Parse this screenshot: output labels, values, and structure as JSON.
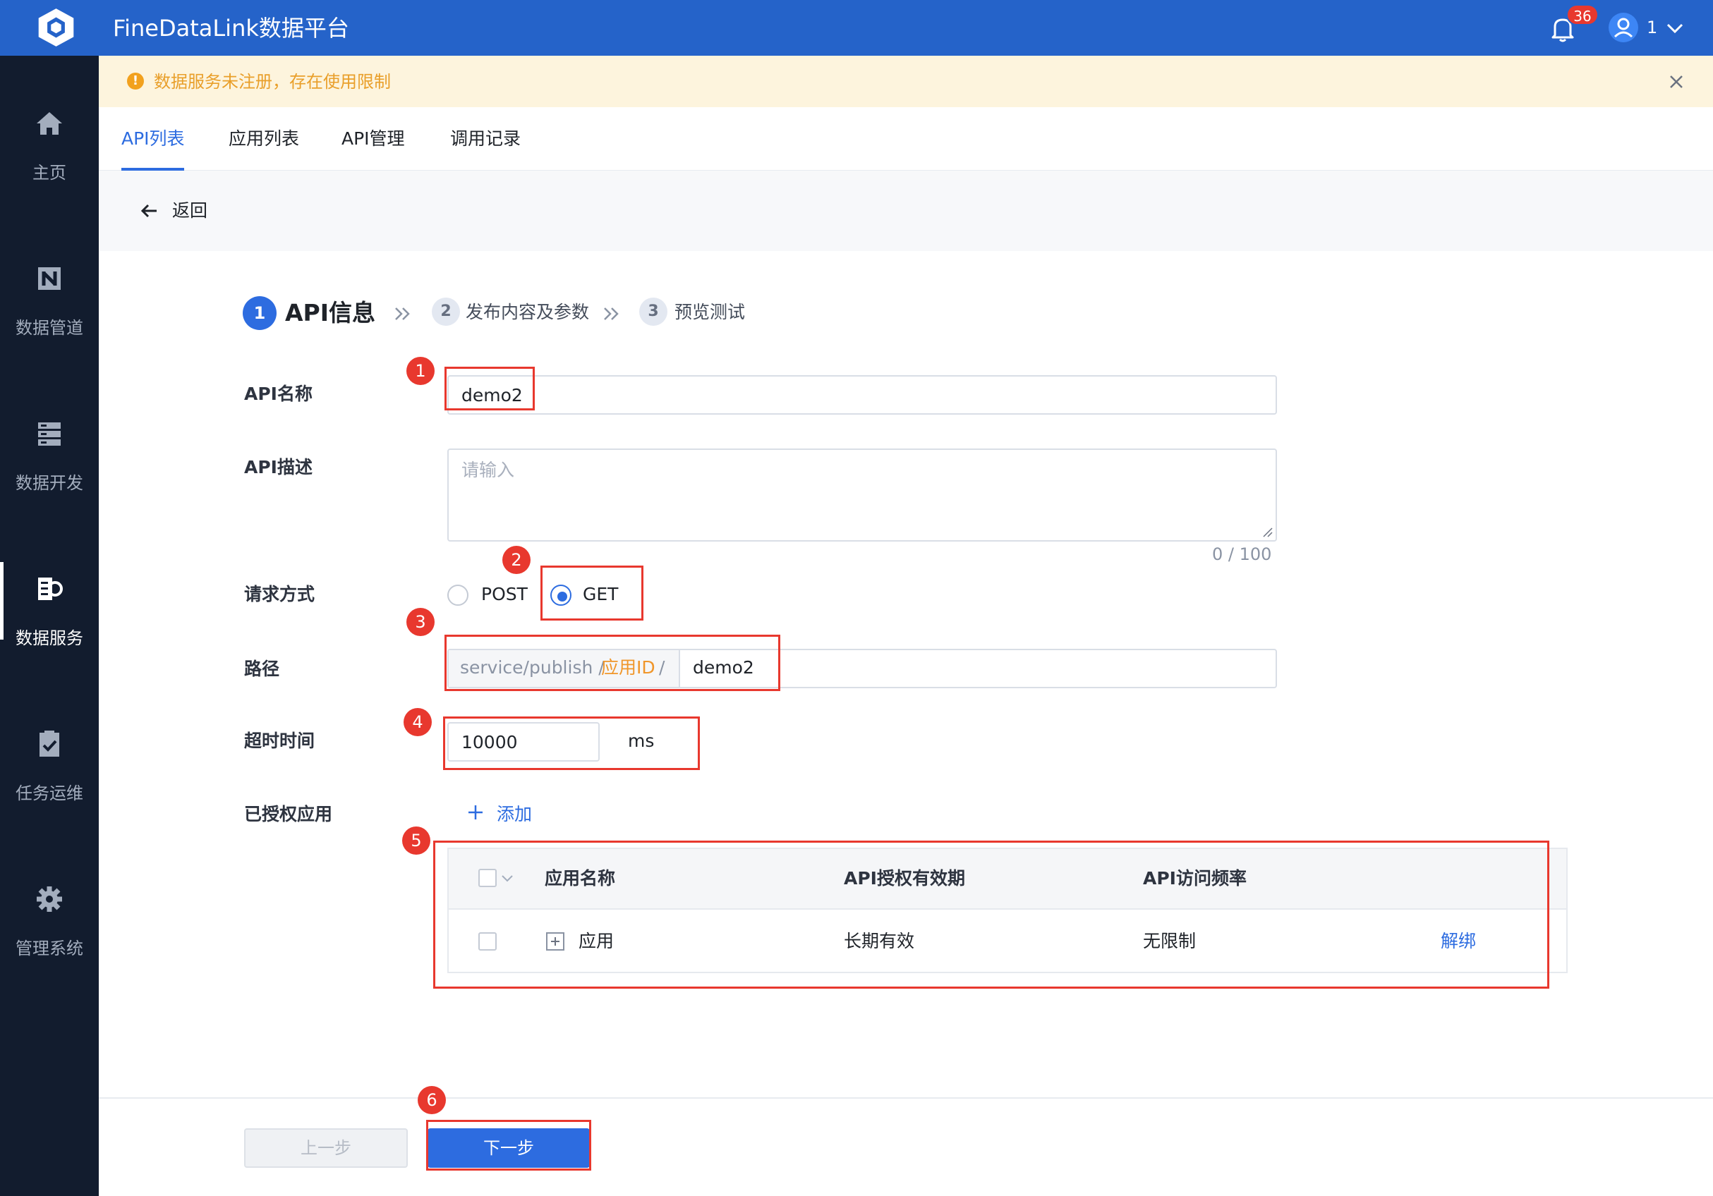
{
  "header": {
    "title": "FineDataLink数据平台",
    "notification_count": "36",
    "user_name": "1"
  },
  "sidebar": {
    "items": [
      {
        "label": "主页",
        "icon": "home-icon"
      },
      {
        "label": "数据管道",
        "icon": "pipeline-icon"
      },
      {
        "label": "数据开发",
        "icon": "data-dev-icon"
      },
      {
        "label": "数据服务",
        "icon": "data-service-icon",
        "active": true
      },
      {
        "label": "任务运维",
        "icon": "task-ops-icon"
      },
      {
        "label": "管理系统",
        "icon": "gear-icon"
      }
    ]
  },
  "notice": {
    "text": "数据服务未注册，存在使用限制"
  },
  "tabs": [
    {
      "label": "API列表",
      "active": true
    },
    {
      "label": "应用列表"
    },
    {
      "label": "API管理"
    },
    {
      "label": "调用记录"
    }
  ],
  "back": {
    "label": "返回"
  },
  "steps": [
    {
      "num": "1",
      "label": "API信息",
      "active": true
    },
    {
      "num": "2",
      "label": "发布内容及参数"
    },
    {
      "num": "3",
      "label": "预览测试"
    }
  ],
  "form": {
    "name_label": "API名称",
    "name_value": "demo2",
    "desc_label": "API描述",
    "desc_placeholder": "请输入",
    "desc_count": "0 / 100",
    "method_label": "请求方式",
    "method_options": [
      "POST",
      "GET"
    ],
    "method_selected": "GET",
    "path_label": "路径",
    "path_prefix": "service/publish /",
    "path_appid": "应用ID",
    "path_slash": "/",
    "path_value": "demo2",
    "timeout_label": "超时时间",
    "timeout_value": "10000",
    "timeout_unit": "ms",
    "auth_label": "已授权应用",
    "add_label": "添加"
  },
  "table": {
    "columns": [
      "应用名称",
      "API授权有效期",
      "API访问频率"
    ],
    "rows": [
      {
        "name": "应用",
        "validity": "长期有效",
        "frequency": "无限制",
        "action": "解绑"
      }
    ]
  },
  "footer": {
    "prev_label": "上一步",
    "next_label": "下一步"
  },
  "annotations": [
    "1",
    "2",
    "3",
    "4",
    "5",
    "6"
  ],
  "colors": {
    "header": "#2563c9",
    "sidebar": "#121c2e",
    "accent": "#2d6ce0",
    "annotation": "#e8382e",
    "warning": "#f2a11e"
  }
}
